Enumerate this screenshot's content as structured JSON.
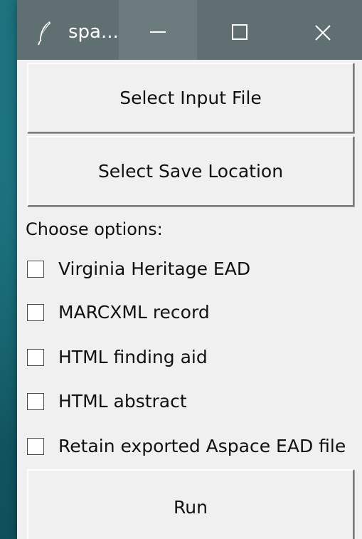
{
  "window": {
    "title": "spa...",
    "titlebar_color": "#5f6f72",
    "background_color": "#f0f0f0",
    "controls": {
      "minimize_icon": "minimize-icon",
      "maximize_icon": "maximize-icon",
      "close_icon": "close-icon"
    },
    "app_icon": "feather-icon"
  },
  "buttons": {
    "select_input": "Select Input File",
    "select_save": "Select Save Location",
    "run": "Run"
  },
  "options": {
    "heading": "Choose options:",
    "items": [
      {
        "label": "Virginia Heritage EAD",
        "checked": false
      },
      {
        "label": "MARCXML record",
        "checked": false
      },
      {
        "label": "HTML finding aid",
        "checked": false
      },
      {
        "label": "HTML abstract",
        "checked": false
      },
      {
        "label": "Retain exported Aspace EAD file",
        "checked": false
      }
    ]
  }
}
